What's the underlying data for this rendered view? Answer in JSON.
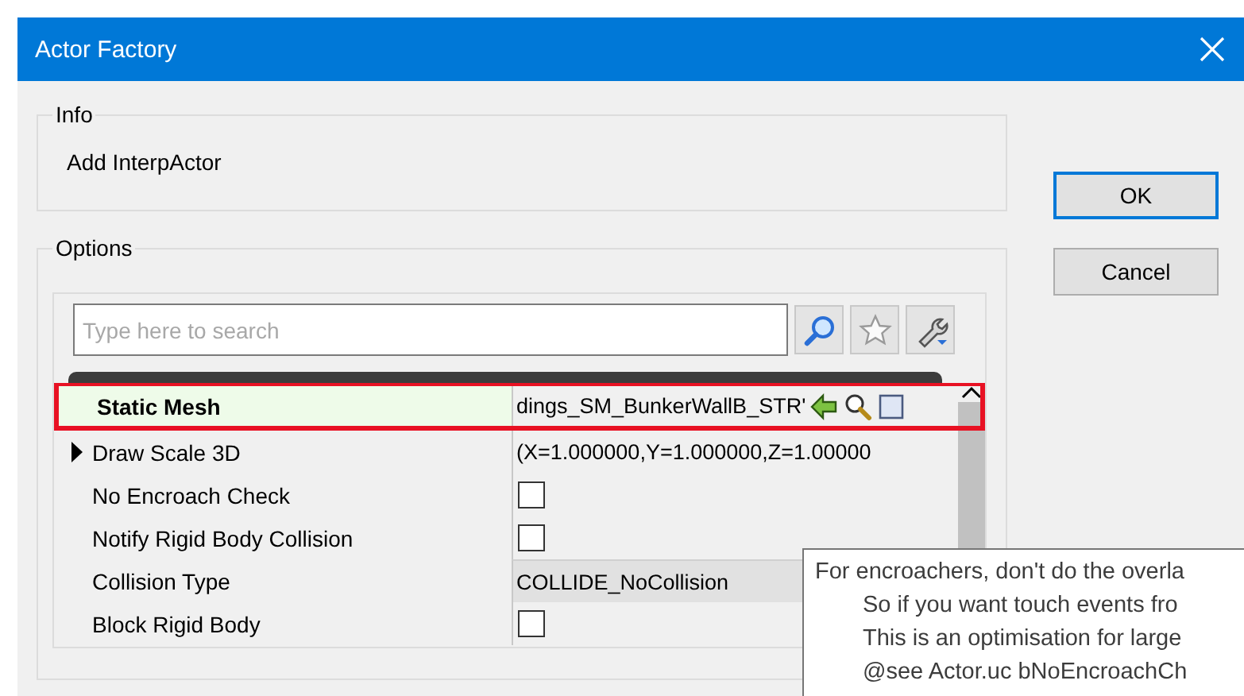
{
  "window": {
    "title": "Actor Factory"
  },
  "info": {
    "title": "Info",
    "text": "Add InterpActor"
  },
  "buttons": [
    {
      "label": "OK",
      "default": true
    },
    {
      "label": "Cancel",
      "default": false
    }
  ],
  "options": {
    "title": "Options",
    "search": {
      "placeholder": "Type here to search"
    },
    "properties": [
      {
        "name": "Static Mesh",
        "kind": "asset",
        "value": "dings_SM_BunkerWallB_STR'",
        "selected": true
      },
      {
        "name": "Draw Scale 3D",
        "kind": "struct",
        "value": "(X=1.000000,Y=1.000000,Z=1.00000",
        "expanded": false,
        "selected": false
      },
      {
        "name": "No Encroach Check",
        "kind": "checkbox",
        "checked": false,
        "selected": false
      },
      {
        "name": "Notify Rigid Body Collision",
        "kind": "checkbox",
        "checked": false,
        "selected": false
      },
      {
        "name": "Collision Type",
        "kind": "combo",
        "value": "COLLIDE_NoCollision",
        "selected": false
      },
      {
        "name": "Block Rigid Body",
        "kind": "checkbox",
        "checked": false,
        "selected": false
      }
    ]
  },
  "tooltip": {
    "lines": [
      {
        "text": "For encroachers, don't do the overla",
        "indented": false
      },
      {
        "text": "So if you want touch events fro",
        "indented": true
      },
      {
        "text": "This is an optimisation for large",
        "indented": true
      },
      {
        "text": "@see Actor.uc bNoEncroachCh",
        "indented": true
      }
    ]
  }
}
